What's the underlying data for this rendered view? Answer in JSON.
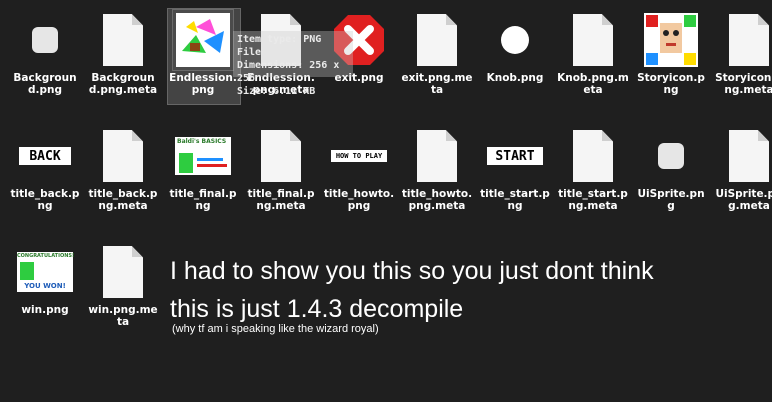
{
  "files": [
    {
      "label": "Background.png",
      "icon": "rounded-square-icon"
    },
    {
      "label": "Background.png.meta",
      "icon": "document-icon"
    },
    {
      "label": "Endlession.png",
      "icon": "image-thumbnail-icon"
    },
    {
      "label": "Endlession.png.meta",
      "icon": "document-icon"
    },
    {
      "label": "exit.png",
      "icon": "red-x-icon"
    },
    {
      "label": "exit.png.meta",
      "icon": "document-icon"
    },
    {
      "label": "Knob.png",
      "icon": "circle-icon"
    },
    {
      "label": "Knob.png.meta",
      "icon": "document-icon"
    },
    {
      "label": "Storyicon.png",
      "icon": "face-thumbnail-icon"
    },
    {
      "label": "Storyicon.png.meta",
      "icon": "document-icon"
    },
    {
      "label": "title_back.png",
      "icon": "back-banner-icon",
      "banner": "BACK"
    },
    {
      "label": "title_back.png.meta",
      "icon": "document-icon"
    },
    {
      "label": "title_final.png",
      "icon": "final-thumbnail-icon"
    },
    {
      "label": "title_final.png.meta",
      "icon": "document-icon"
    },
    {
      "label": "title_howto.png",
      "icon": "howto-banner-icon",
      "banner": "HOW TO PLAY"
    },
    {
      "label": "title_howto.png.meta",
      "icon": "document-icon"
    },
    {
      "label": "title_start.png",
      "icon": "start-banner-icon",
      "banner": "START"
    },
    {
      "label": "title_start.png.meta",
      "icon": "document-icon"
    },
    {
      "label": "UiSprite.png",
      "icon": "rounded-square-icon"
    },
    {
      "label": "UiSprite.png.meta",
      "icon": "document-icon"
    },
    {
      "label": "win.png",
      "icon": "win-thumbnail-icon",
      "banner": "YOU WON!"
    },
    {
      "label": "win.png.meta",
      "icon": "document-icon"
    }
  ],
  "tooltip": {
    "line1": "Item type: PNG File",
    "line2": "Dimensions: 256 x 256",
    "line3": "Size: 6.11 KB"
  },
  "caption": {
    "line1": "I had to show you this so you just dont think",
    "line2": "this is just 1.4.3 decompile",
    "sub": "(why tf am i speaking like the wizard royal)"
  },
  "thumb_texts": {
    "final_top": "Baldi's BASICS",
    "win_top": "CONGRATULATIONS!"
  }
}
